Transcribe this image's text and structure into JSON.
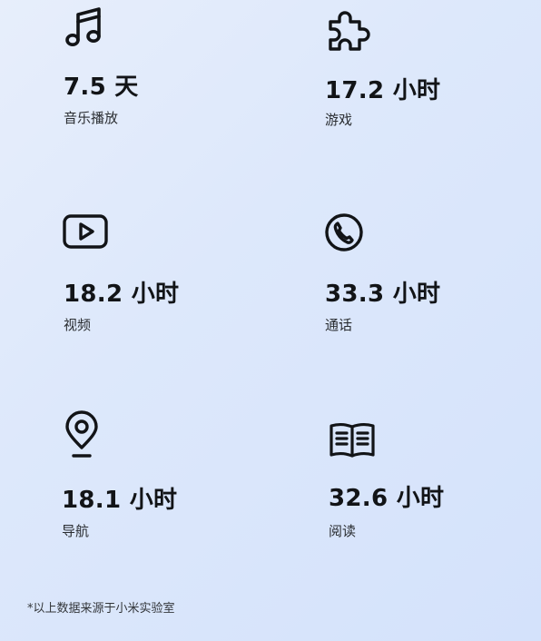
{
  "stats": [
    {
      "icon": "music-note-icon",
      "value": "7.5 天",
      "label": "音乐播放"
    },
    {
      "icon": "puzzle-icon",
      "value": "17.2 小时",
      "label": "游戏"
    },
    {
      "icon": "video-play-icon",
      "value": "18.2 小时",
      "label": "视频"
    },
    {
      "icon": "phone-call-icon",
      "value": "33.3 小时",
      "label": "通话"
    },
    {
      "icon": "location-pin-icon",
      "value": "18.1 小时",
      "label": "导航"
    },
    {
      "icon": "open-book-icon",
      "value": "32.6 小时",
      "label": "阅读"
    }
  ],
  "footnote": "*以上数据来源于小米实验室"
}
